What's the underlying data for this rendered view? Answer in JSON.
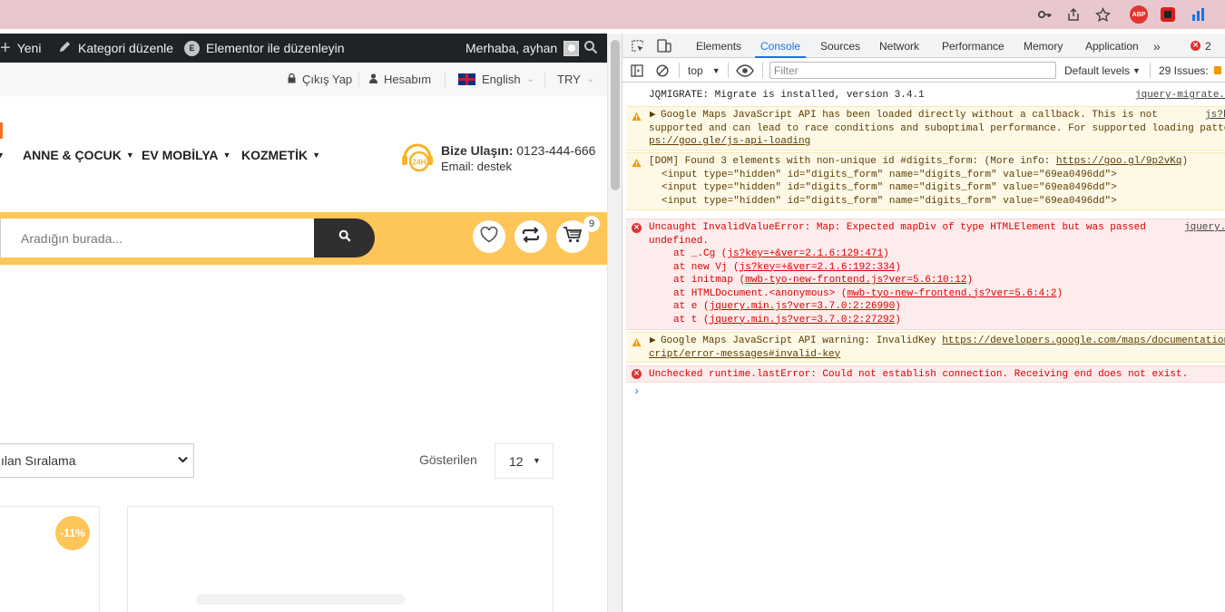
{
  "site": {
    "admin_bar": {
      "new_label": "Yeni",
      "edit_category_label": "Kategori düzenle",
      "elementor_label": "Elementor ile düzenleyin",
      "greeting": "Merhaba, ayhan"
    },
    "topbar": {
      "logout": "Çıkış Yap",
      "account": "Hesabım",
      "language": "English",
      "currency": "TRY"
    },
    "nav": {
      "items": [
        "ANNE & ÇOCUK",
        "EV MOBİLYA",
        "KOZMETİK"
      ]
    },
    "contact": {
      "label": "Bize Ulaşın:",
      "phone": "0123-444-666",
      "email": "Email: destek",
      "badge": "24H"
    },
    "search": {
      "placeholder": "Aradığın burada..."
    },
    "cart_count": "9",
    "sort_value": "ılan Sıralama",
    "shown_label": "Gösterilen",
    "per_page": "12",
    "discount_badge": "-11%",
    "colors": {
      "accent": "#fec558",
      "dark": "#2f2f2f",
      "admin_bar": "#1d2327"
    }
  },
  "devtools": {
    "tabs": [
      "Elements",
      "Console",
      "Sources",
      "Network",
      "Performance",
      "Memory",
      "Application"
    ],
    "active_tab": "Console",
    "error_count": "2",
    "toolbar": {
      "context": "top",
      "filter_placeholder": "Filter",
      "levels": "Default levels",
      "issues": "29 Issues:"
    },
    "messages": {
      "m1": {
        "text": "JQMIGRATE: Migrate is installed, version 3.4.1",
        "source": "jquery-migrate."
      },
      "m2": {
        "l1": "Google Maps JavaScript API has been loaded directly without a callback. This is not",
        "l2": "supported and can lead to race conditions and suboptimal performance. For supported loading patte",
        "l3": "ps://goo.gle/js-api-loading",
        "source": "js?k"
      },
      "m3": {
        "l1_text": "[DOM] Found 3 elements with non-unique id #digits_form: (More info: ",
        "l1_link": "https://goo.gl/9p2vKq",
        "l1_end": ")",
        "l2": "<input type=\"hidden\" id=\"digits_form\" name=\"digits_form\" value=\"69ea0496dd\">",
        "l3": "<input type=\"hidden\" id=\"digits_form\" name=\"digits_form\" value=\"69ea0496dd\">",
        "l4": "<input type=\"hidden\" id=\"digits_form\" name=\"digits_form\" value=\"69ea0496dd\">"
      },
      "m4": {
        "l1": "Uncaught InvalidValueError: Map: Expected mapDiv of type HTMLElement but was passed",
        "l2": "undefined.",
        "source": "jquery.",
        "stack": [
          {
            "fn": "at _.Cg (",
            "link": "js?key=+&ver=2.1.6:129:471",
            "end": ")"
          },
          {
            "fn": "at new Vj (",
            "link": "js?key=+&ver=2.1.6:192:334",
            "end": ")"
          },
          {
            "fn": "at initmap (",
            "link": "mwb-tyo-new-frontend.js?ver=5.6:10:12",
            "end": ")"
          },
          {
            "fn": "at HTMLDocument.<anonymous> (",
            "link": "mwb-tyo-new-frontend.js?ver=5.6:4:2",
            "end": ")"
          },
          {
            "fn": "at e (",
            "link": "jquery.min.js?ver=3.7.0:2:26990",
            "end": ")"
          },
          {
            "fn": "at t (",
            "link": "jquery.min.js?ver=3.7.0:2:27292",
            "end": ")"
          }
        ]
      },
      "m5": {
        "l1_text": "Google Maps JavaScript API warning: InvalidKey ",
        "l1_link": "https://developers.google.com/maps/documentation",
        "l2": "cript/error-messages#invalid-key"
      },
      "m6": {
        "text": "Unchecked runtime.lastError: Could not establish connection. Receiving end does not exist."
      }
    },
    "prompt": "›"
  }
}
